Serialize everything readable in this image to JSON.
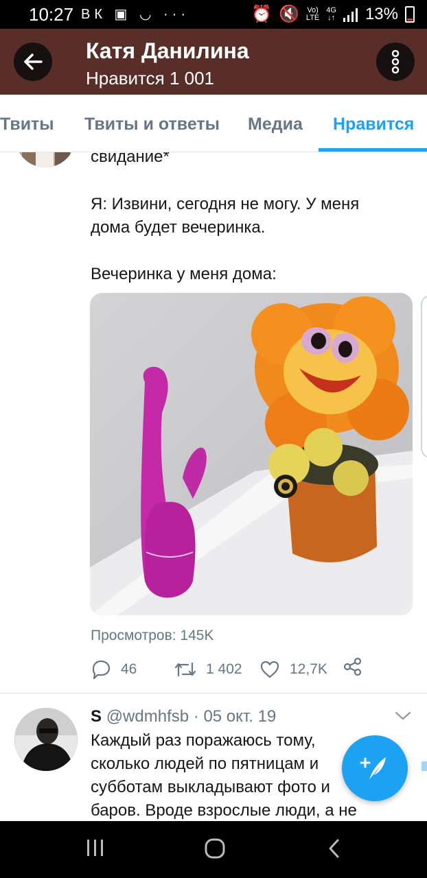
{
  "status_bar": {
    "time": "10:27",
    "notifications": "ВК ▣ ◡  ···",
    "signal_label_top": "Vo)",
    "signal_label_bottom": "LTE",
    "network_label_top": "4G",
    "network_label_bottom": "↓↑",
    "battery": "13%"
  },
  "header": {
    "title": "Катя Данилина",
    "subtitle": "Нравится 1 001",
    "back_icon": "arrow-left-icon",
    "more_icon": "more-vertical-icon",
    "color": "#5a2e28"
  },
  "tabs": [
    {
      "label": "Твиты",
      "active": false
    },
    {
      "label": "Твиты и ответы",
      "active": false
    },
    {
      "label": "Медиа",
      "active": false
    },
    {
      "label": "Нравится",
      "active": true
    }
  ],
  "tweet1": {
    "lines": [
      "свидание*",
      "Я: Извини, сегодня не могу. У меня",
      "дома будет вечеринка.",
      "Вечеринка у меня дома:"
    ],
    "views": "Просмотров: 145K",
    "replies": "46",
    "retweets": "1 402",
    "likes": "12,7K"
  },
  "tweet2": {
    "name": "S",
    "handle": "@wdmhfsb",
    "separator": "·",
    "date": "05 окт. 19",
    "lines": [
      "Каждый раз поражаюсь тому,",
      "сколько людей по пятницам и",
      "субботам выкладывают фото и",
      "баров. Вроде взрослые люди, а не"
    ]
  },
  "accent_color": "#1da1f2"
}
